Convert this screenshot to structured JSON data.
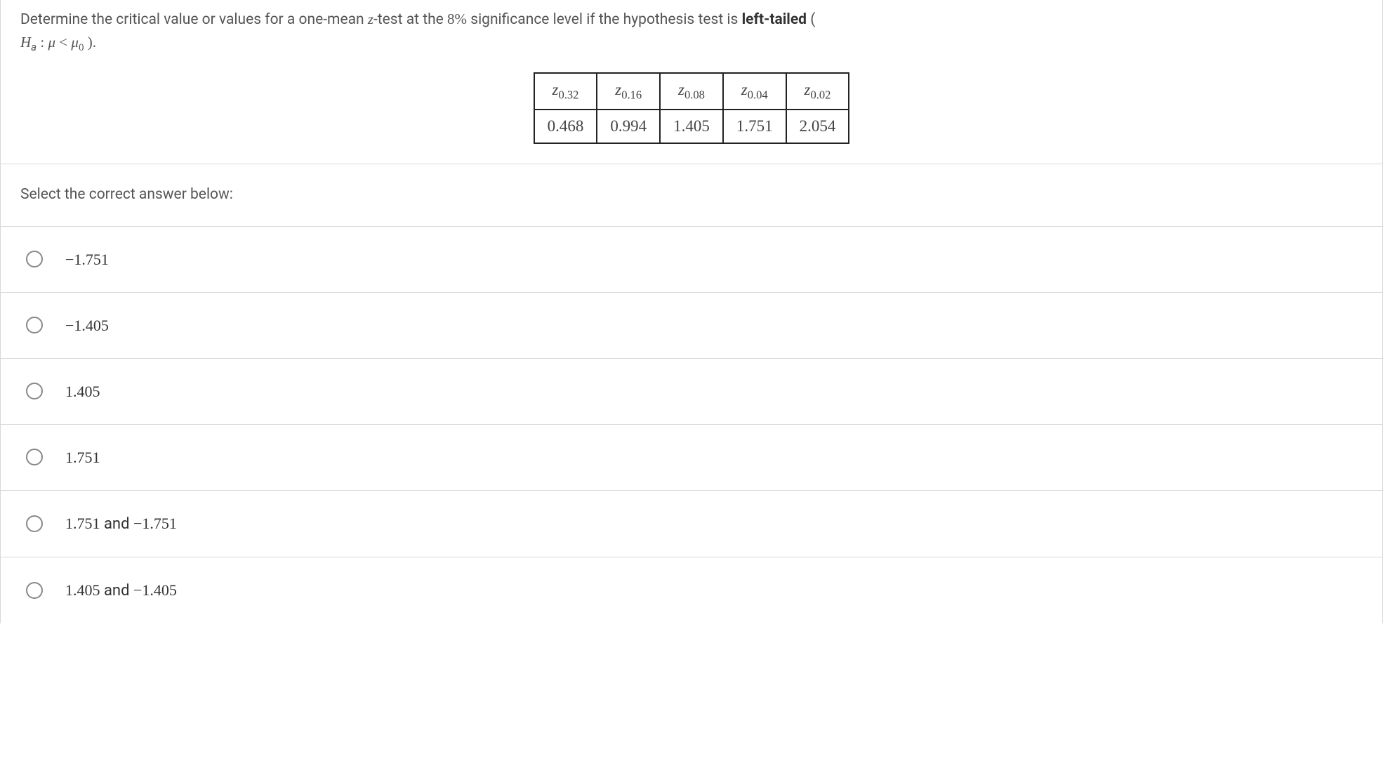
{
  "question": {
    "prefix": "Determine the critical value or values for a one-mean ",
    "ztest": "z",
    "mid1": "-test at the ",
    "pct": "8%",
    "mid2": " significance level if the hypothesis test is ",
    "tail_label": "left-tailed",
    "open_paren": " ( ",
    "hyp_H": "H",
    "hyp_sub": "a",
    "colon": " : ",
    "mu": "μ",
    "lt": " < ",
    "mu0_mu": "μ",
    "mu0_sub": "0",
    "close": " )."
  },
  "z_table": {
    "headers": [
      {
        "z": "z",
        "sub": "0.32"
      },
      {
        "z": "z",
        "sub": "0.16"
      },
      {
        "z": "z",
        "sub": "0.08"
      },
      {
        "z": "z",
        "sub": "0.04"
      },
      {
        "z": "z",
        "sub": "0.02"
      }
    ],
    "values": [
      "0.468",
      "0.994",
      "1.405",
      "1.751",
      "2.054"
    ]
  },
  "prompt": "Select the correct answer below:",
  "options": [
    {
      "a": "−1.751"
    },
    {
      "a": "−1.405"
    },
    {
      "a": "1.405"
    },
    {
      "a": "1.751"
    },
    {
      "a": "1.751",
      "and": " and ",
      "b": "−1.751"
    },
    {
      "a": "1.405",
      "and": " and ",
      "b": "−1.405"
    }
  ]
}
